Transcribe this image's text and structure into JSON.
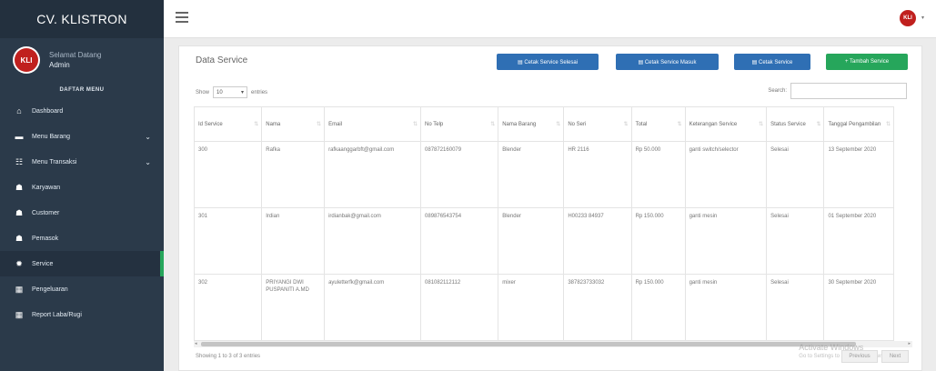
{
  "sidebar": {
    "brand": "CV. KLISTRON",
    "logo_text": "KLI",
    "welcome": "Selamat Datang",
    "username": "Admin",
    "menu_header": "DAFTAR MENU",
    "items": [
      {
        "label": "Dashboard",
        "icon": "home-icon",
        "glyph": "⌂"
      },
      {
        "label": "Menu Barang",
        "icon": "truck-icon",
        "glyph": "▬",
        "has_sub": true
      },
      {
        "label": "Menu Transaksi",
        "icon": "list-icon",
        "glyph": "☷",
        "has_sub": true
      },
      {
        "label": "Karyawan",
        "icon": "users-icon",
        "glyph": "☗"
      },
      {
        "label": "Customer",
        "icon": "users-icon",
        "glyph": "☗"
      },
      {
        "label": "Pemasok",
        "icon": "users-icon",
        "glyph": "☗"
      },
      {
        "label": "Service",
        "icon": "gear-icon",
        "glyph": "✹",
        "active": true
      },
      {
        "label": "Pengeluaran",
        "icon": "table-icon",
        "glyph": "▦"
      },
      {
        "label": "Report Laba/Rugi",
        "icon": "table-icon",
        "glyph": "▦"
      }
    ]
  },
  "topbar": {
    "menu_icon": "hamburger-icon",
    "logo_text": "KLI"
  },
  "content": {
    "title": "Data Service",
    "buttons": [
      {
        "label": "▤ Cetak Service Selesai",
        "color": "#2f6fb4"
      },
      {
        "label": "▤ Cetak Service Masuk",
        "color": "#2f6fb4"
      },
      {
        "label": "▤ Cetak Service",
        "color": "#2f6fb4"
      },
      {
        "label": "+ Tambah Service",
        "color": "#26a65b"
      }
    ],
    "show_label": "Show",
    "length_value": "10",
    "entries_label": "entries",
    "search_label": "Search:",
    "search_value": "",
    "columns": [
      "Id Service",
      "Nama",
      "Email",
      "No Telp",
      "Nama Barang",
      "No Seri",
      "Total",
      "Keterangan Service",
      "Status Service",
      "Tanggal Pengambilan"
    ],
    "rows": [
      [
        "300",
        "Rafka",
        "rafkaanggarbft@gmail.com",
        "087872160079",
        "Blender",
        "HR 2116",
        "Rp 50.000",
        "ganti switch/selector",
        "Selesai",
        "13 September 2020"
      ],
      [
        "301",
        "Irdian",
        "irdianbak@gmail.com",
        "089876543754",
        "Blender",
        "H00233 84937",
        "Rp 150.000",
        "ganti mesin",
        "Selesai",
        "01 September 2020"
      ],
      [
        "302",
        "PRIYANGI DWI PUSPANITI A.MD",
        "ayuletterfk@gmail.com",
        "081082112112",
        "mixer",
        "387823733032",
        "Rp 150.000",
        "ganti mesin",
        "Selesai",
        "30 September 2020"
      ]
    ],
    "info": "Showing 1 to 3 of 3 entries",
    "prev_label": "Previous",
    "next_label": "Next",
    "watermark": "Activate Windows",
    "watermark_sub": "Go to Settings to activate Windows."
  }
}
